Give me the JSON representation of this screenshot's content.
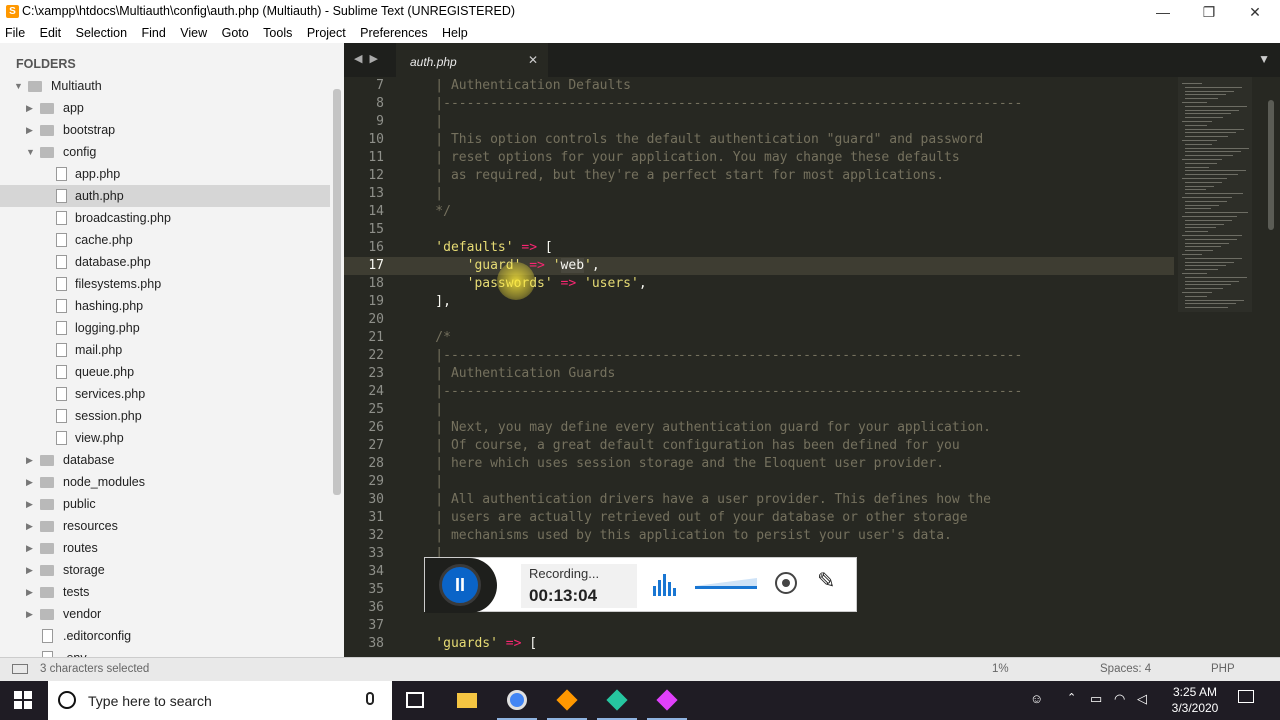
{
  "window": {
    "title": "C:\\xampp\\htdocs\\Multiauth\\config\\auth.php (Multiauth) - Sublime Text (UNREGISTERED)",
    "controls": {
      "minimize": "—",
      "restore": "❐",
      "close": "✕"
    }
  },
  "menu": [
    "File",
    "Edit",
    "Selection",
    "Find",
    "View",
    "Goto",
    "Tools",
    "Project",
    "Preferences",
    "Help"
  ],
  "sidebar": {
    "header": "FOLDERS",
    "items": [
      {
        "label": "Multiauth",
        "type": "folder",
        "level": 0,
        "open": true
      },
      {
        "label": "app",
        "type": "folder",
        "level": 1,
        "open": false
      },
      {
        "label": "bootstrap",
        "type": "folder",
        "level": 1,
        "open": false
      },
      {
        "label": "config",
        "type": "folder",
        "level": 1,
        "open": true
      },
      {
        "label": "app.php",
        "type": "file",
        "level": 2
      },
      {
        "label": "auth.php",
        "type": "file",
        "level": 2,
        "selected": true
      },
      {
        "label": "broadcasting.php",
        "type": "file",
        "level": 2
      },
      {
        "label": "cache.php",
        "type": "file",
        "level": 2
      },
      {
        "label": "database.php",
        "type": "file",
        "level": 2
      },
      {
        "label": "filesystems.php",
        "type": "file",
        "level": 2
      },
      {
        "label": "hashing.php",
        "type": "file",
        "level": 2
      },
      {
        "label": "logging.php",
        "type": "file",
        "level": 2
      },
      {
        "label": "mail.php",
        "type": "file",
        "level": 2
      },
      {
        "label": "queue.php",
        "type": "file",
        "level": 2
      },
      {
        "label": "services.php",
        "type": "file",
        "level": 2
      },
      {
        "label": "session.php",
        "type": "file",
        "level": 2
      },
      {
        "label": "view.php",
        "type": "file",
        "level": 2
      },
      {
        "label": "database",
        "type": "folder",
        "level": 1,
        "open": false
      },
      {
        "label": "node_modules",
        "type": "folder",
        "level": 1,
        "open": false
      },
      {
        "label": "public",
        "type": "folder",
        "level": 1,
        "open": false
      },
      {
        "label": "resources",
        "type": "folder",
        "level": 1,
        "open": false
      },
      {
        "label": "routes",
        "type": "folder",
        "level": 1,
        "open": false
      },
      {
        "label": "storage",
        "type": "folder",
        "level": 1,
        "open": false
      },
      {
        "label": "tests",
        "type": "folder",
        "level": 1,
        "open": false
      },
      {
        "label": "vendor",
        "type": "folder",
        "level": 1,
        "open": false
      },
      {
        "label": ".editorconfig",
        "type": "file",
        "level": 1
      },
      {
        "label": ".env",
        "type": "file",
        "level": 1
      }
    ]
  },
  "tabs": {
    "nav": "◀ ▶",
    "active": "auth.php",
    "close": "✕",
    "dropdown": "▼"
  },
  "editor": {
    "current_line": 17,
    "lines": [
      {
        "n": 7,
        "parts": [
          [
            "cm",
            "    | Authentication Defaults"
          ]
        ]
      },
      {
        "n": 8,
        "parts": [
          [
            "cm",
            "    |--------------------------------------------------------------------------"
          ]
        ]
      },
      {
        "n": 9,
        "parts": [
          [
            "cm",
            "    |"
          ]
        ]
      },
      {
        "n": 10,
        "parts": [
          [
            "cm",
            "    | This option controls the default authentication \"guard\" and password"
          ]
        ]
      },
      {
        "n": 11,
        "parts": [
          [
            "cm",
            "    | reset options for your application. You may change these defaults"
          ]
        ]
      },
      {
        "n": 12,
        "parts": [
          [
            "cm",
            "    | as required, but they're a perfect start for most applications."
          ]
        ]
      },
      {
        "n": 13,
        "parts": [
          [
            "cm",
            "    |"
          ]
        ]
      },
      {
        "n": 14,
        "parts": [
          [
            "cm",
            "    */"
          ]
        ]
      },
      {
        "n": 15,
        "parts": []
      },
      {
        "n": 16,
        "parts": [
          [
            "st",
            "    'defaults'"
          ],
          [
            "op",
            " =>"
          ],
          [
            "pl",
            " ["
          ]
        ]
      },
      {
        "n": 17,
        "parts": [
          [
            "st",
            "        'guard'"
          ],
          [
            "op",
            " =>"
          ],
          [
            "st",
            " '"
          ],
          [
            "sel",
            "web"
          ],
          [
            "st",
            "'"
          ],
          [
            "pl",
            ","
          ]
        ]
      },
      {
        "n": 18,
        "parts": [
          [
            "st",
            "        'passwords'"
          ],
          [
            "op",
            " =>"
          ],
          [
            "st",
            " 'users'"
          ],
          [
            "pl",
            ","
          ]
        ]
      },
      {
        "n": 19,
        "parts": [
          [
            "pl",
            "    ],"
          ]
        ]
      },
      {
        "n": 20,
        "parts": []
      },
      {
        "n": 21,
        "parts": [
          [
            "cm",
            "    /*"
          ]
        ]
      },
      {
        "n": 22,
        "parts": [
          [
            "cm",
            "    |--------------------------------------------------------------------------"
          ]
        ]
      },
      {
        "n": 23,
        "parts": [
          [
            "cm",
            "    | Authentication Guards"
          ]
        ]
      },
      {
        "n": 24,
        "parts": [
          [
            "cm",
            "    |--------------------------------------------------------------------------"
          ]
        ]
      },
      {
        "n": 25,
        "parts": [
          [
            "cm",
            "    |"
          ]
        ]
      },
      {
        "n": 26,
        "parts": [
          [
            "cm",
            "    | Next, you may define every authentication guard for your application."
          ]
        ]
      },
      {
        "n": 27,
        "parts": [
          [
            "cm",
            "    | Of course, a great default configuration has been defined for you"
          ]
        ]
      },
      {
        "n": 28,
        "parts": [
          [
            "cm",
            "    | here which uses session storage and the Eloquent user provider."
          ]
        ]
      },
      {
        "n": 29,
        "parts": [
          [
            "cm",
            "    |"
          ]
        ]
      },
      {
        "n": 30,
        "parts": [
          [
            "cm",
            "    | All authentication drivers have a user provider. This defines how the"
          ]
        ]
      },
      {
        "n": 31,
        "parts": [
          [
            "cm",
            "    | users are actually retrieved out of your database or other storage"
          ]
        ]
      },
      {
        "n": 32,
        "parts": [
          [
            "cm",
            "    | mechanisms used by this application to persist your user's data."
          ]
        ]
      },
      {
        "n": 33,
        "parts": [
          [
            "cm",
            "    |"
          ]
        ]
      },
      {
        "n": 34,
        "parts": []
      },
      {
        "n": 35,
        "parts": []
      },
      {
        "n": 36,
        "parts": []
      },
      {
        "n": 37,
        "parts": []
      },
      {
        "n": 38,
        "parts": [
          [
            "st",
            "    'guards'"
          ],
          [
            "op",
            " =>"
          ],
          [
            "pl",
            " ["
          ]
        ]
      }
    ]
  },
  "recorder": {
    "status": "Recording...",
    "time": "00:13:04",
    "pause": "II",
    "pen": "✎"
  },
  "statusbar": {
    "selection": "3 characters selected",
    "zoom": "1%",
    "indent": "Spaces: 4",
    "syntax": "PHP"
  },
  "taskbar": {
    "search_placeholder": "Type here to search",
    "time": "3:25 AM",
    "date": "3/3/2020",
    "apps": [
      {
        "name": "task-view",
        "color": "#ffffff"
      },
      {
        "name": "file-explorer",
        "color": "#f5c542"
      },
      {
        "name": "chrome",
        "color": "#4285f4"
      },
      {
        "name": "sublime-text",
        "color": "#ff9800"
      },
      {
        "name": "app-green-arrow",
        "color": "#26c6a0"
      },
      {
        "name": "app-multicolor",
        "color": "#e040fb"
      }
    ]
  }
}
